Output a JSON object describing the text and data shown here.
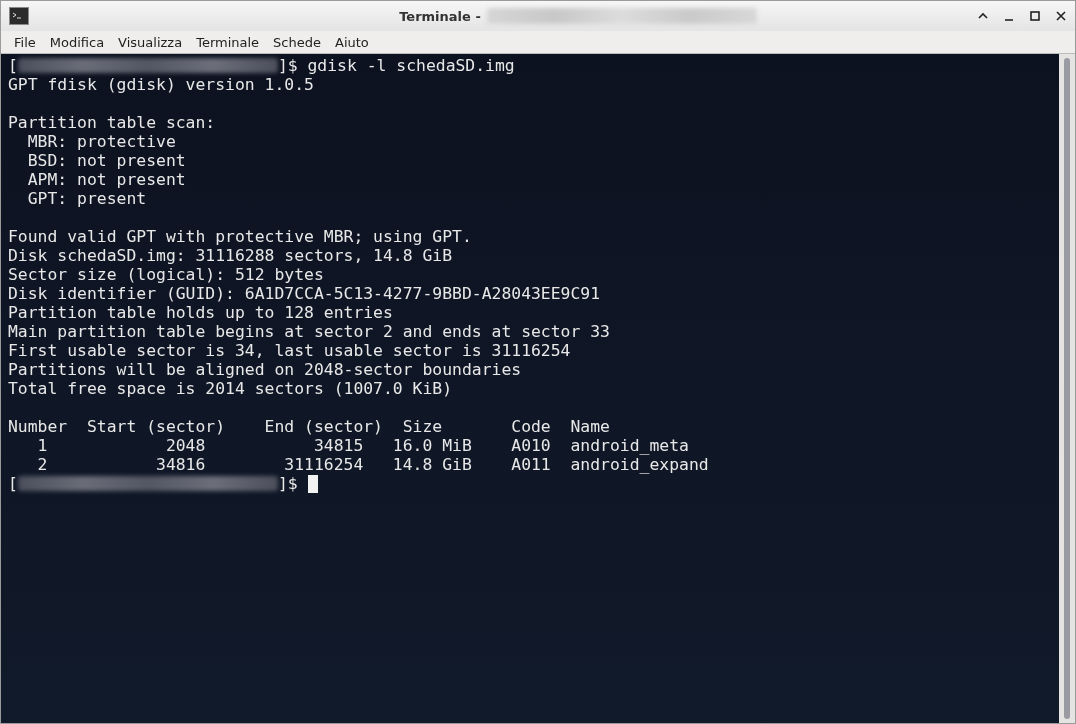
{
  "window": {
    "title": "Terminale -"
  },
  "menu": [
    "File",
    "Modifica",
    "Visualizza",
    "Terminale",
    "Schede",
    "Aiuto"
  ],
  "lines": [
    {
      "kind": "prompt",
      "open": "[",
      "close": "]$ gdisk -l schedaSD.img",
      "cursor": false
    },
    {
      "kind": "text",
      "text": "GPT fdisk (gdisk) version 1.0.5"
    },
    {
      "kind": "blank"
    },
    {
      "kind": "text",
      "text": "Partition table scan:"
    },
    {
      "kind": "text",
      "text": "  MBR: protective"
    },
    {
      "kind": "text",
      "text": "  BSD: not present"
    },
    {
      "kind": "text",
      "text": "  APM: not present"
    },
    {
      "kind": "text",
      "text": "  GPT: present"
    },
    {
      "kind": "blank"
    },
    {
      "kind": "text",
      "text": "Found valid GPT with protective MBR; using GPT."
    },
    {
      "kind": "text",
      "text": "Disk schedaSD.img: 31116288 sectors, 14.8 GiB"
    },
    {
      "kind": "text",
      "text": "Sector size (logical): 512 bytes"
    },
    {
      "kind": "text",
      "text": "Disk identifier (GUID): 6A1D7CCA-5C13-4277-9BBD-A28043EE9C91"
    },
    {
      "kind": "text",
      "text": "Partition table holds up to 128 entries"
    },
    {
      "kind": "text",
      "text": "Main partition table begins at sector 2 and ends at sector 33"
    },
    {
      "kind": "text",
      "text": "First usable sector is 34, last usable sector is 31116254"
    },
    {
      "kind": "text",
      "text": "Partitions will be aligned on 2048-sector boundaries"
    },
    {
      "kind": "text",
      "text": "Total free space is 2014 sectors (1007.0 KiB)"
    },
    {
      "kind": "blank"
    },
    {
      "kind": "text",
      "text": "Number  Start (sector)    End (sector)  Size       Code  Name"
    },
    {
      "kind": "text",
      "text": "   1            2048           34815   16.0 MiB    A010  android_meta"
    },
    {
      "kind": "text",
      "text": "   2           34816        31116254   14.8 GiB    A011  android_expand"
    },
    {
      "kind": "prompt",
      "open": "[",
      "close": "]$",
      "cursor": true
    }
  ]
}
